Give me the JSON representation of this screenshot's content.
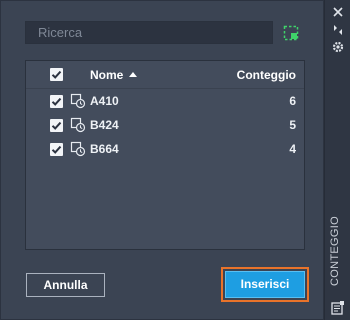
{
  "search": {
    "placeholder": "Ricerca",
    "value": "",
    "select_icon": "dashed-selection-icon"
  },
  "list": {
    "header": {
      "all_checked": true,
      "name_label": "Nome",
      "count_label": "Conteggio",
      "sort": "ascending"
    },
    "rows": [
      {
        "checked": true,
        "name": "A410",
        "count": "6",
        "icon": "block-icon"
      },
      {
        "checked": true,
        "name": "B424",
        "count": "5",
        "icon": "block-icon"
      },
      {
        "checked": true,
        "name": "B664",
        "count": "4",
        "icon": "block-icon"
      }
    ]
  },
  "buttons": {
    "cancel_label": "Annulla",
    "insert_label": "Inserisci"
  },
  "side_panel": {
    "title": "CONTEGGIO",
    "icons": [
      "close-icon",
      "auto-hide-icon",
      "settings-icon",
      "properties-icon"
    ]
  },
  "colors": {
    "background": "#3b4453",
    "panel": "#434c5c",
    "accent_blue": "#1e9ee2",
    "highlight_orange": "#e8732a",
    "select_icon_green": "#3fd46a"
  }
}
